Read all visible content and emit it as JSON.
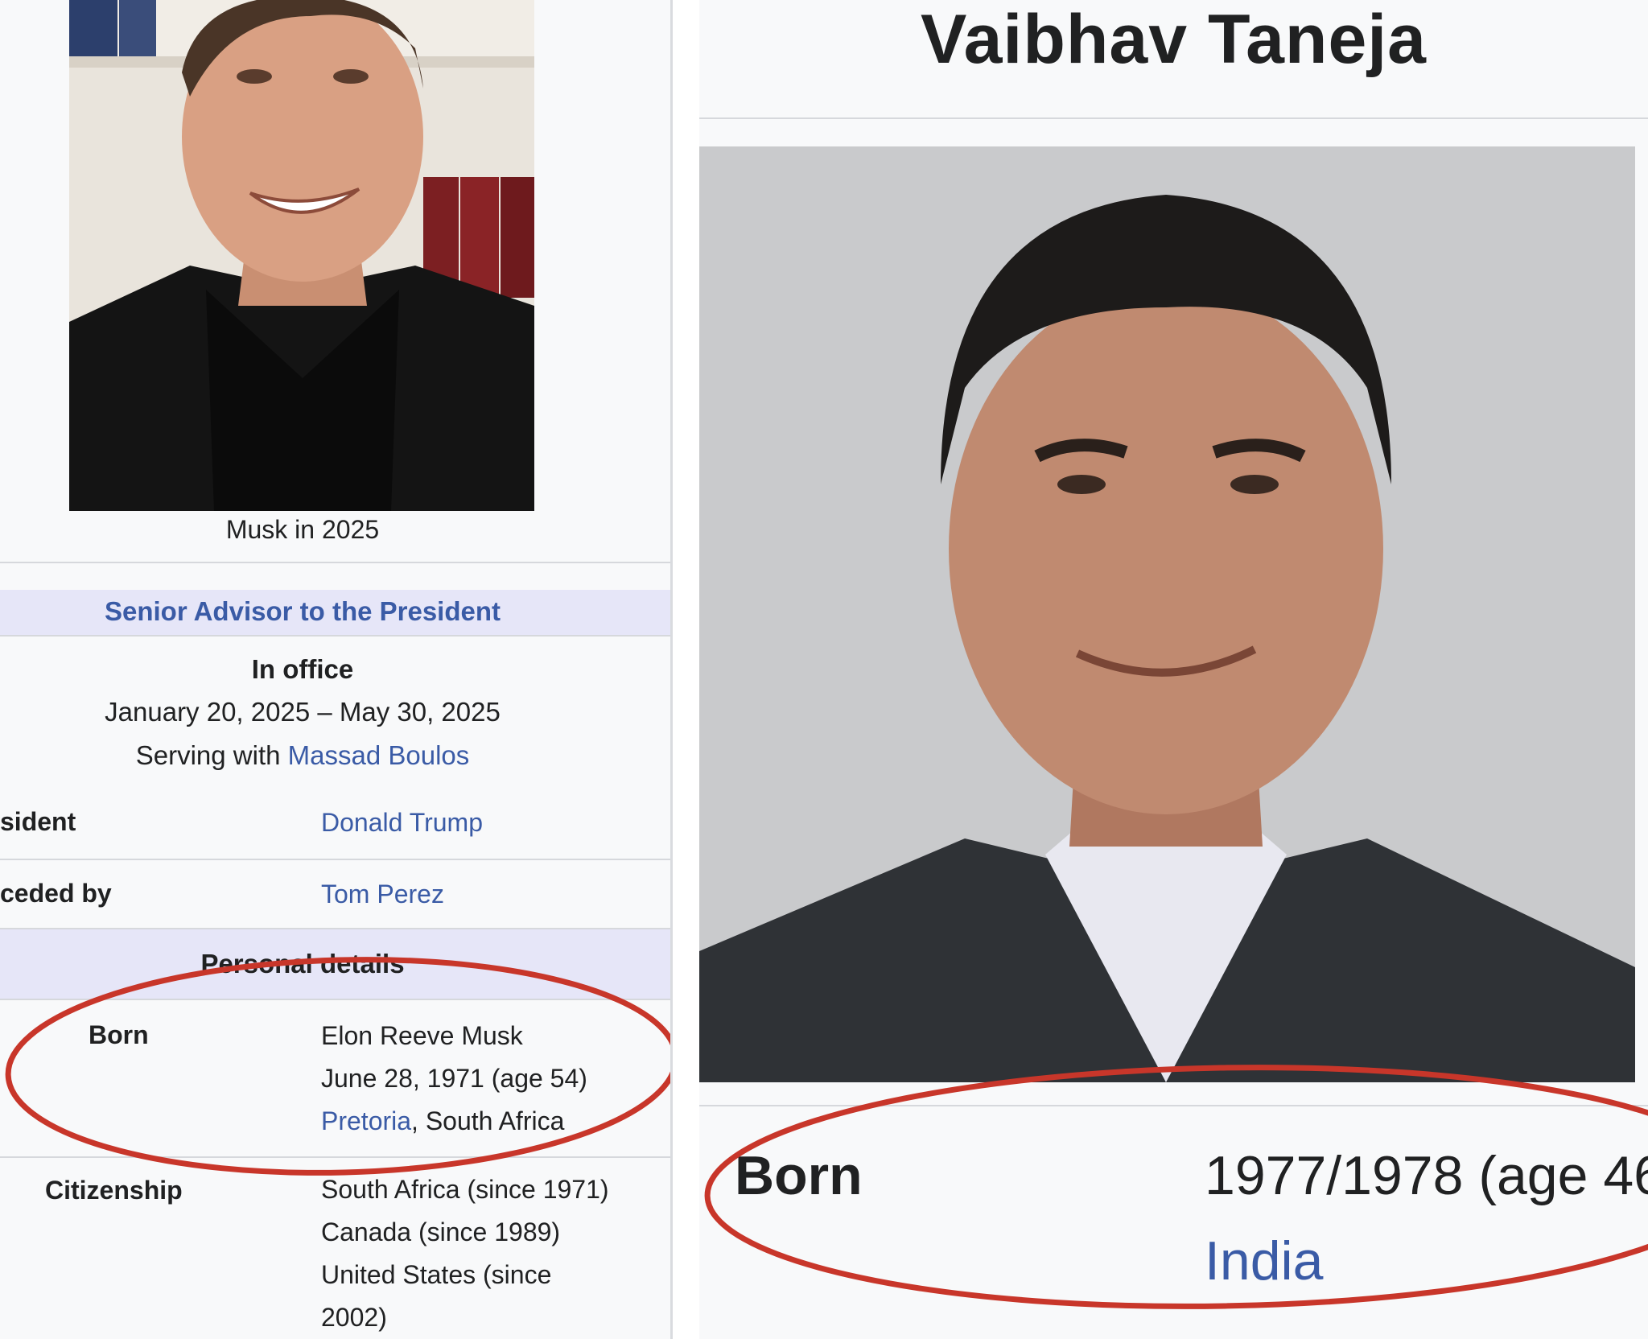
{
  "left_infobox": {
    "photo_alt": "Portrait of Elon Musk",
    "caption": "Musk in 2025",
    "section_header": "Senior Advisor to the President",
    "in_office_label": "In office",
    "term": "January 20, 2025 – May 30, 2025",
    "serving_with_prefix": "Serving with ",
    "serving_with_link": "Massad Boulos",
    "rows": [
      {
        "label": "sident",
        "value": "Donald Trump"
      },
      {
        "label": "ceded by",
        "value": "Tom Perez"
      }
    ],
    "personal_details_header": "Personal details",
    "born_label": "Born",
    "born_lines": {
      "name": "Elon Reeve Musk",
      "date": "June 28, 1971 (age 54)",
      "place_link": "Pretoria",
      "place_rest": ", South Africa"
    },
    "citizenship_label": "Citizenship",
    "citizenship_lines": [
      "South Africa (since 1971)",
      "Canada (since 1989)",
      "United States (since",
      "2002)"
    ]
  },
  "right_infobox": {
    "title": "Vaibhav Taneja",
    "photo_alt": "Portrait of Vaibhav Taneja",
    "born_label": "Born",
    "born_value": "1977/1978 (age 46",
    "born_place_link": "India"
  },
  "colors": {
    "link": "#3a5ba6",
    "header_band": "#e6e6f8",
    "highlight_oval": "#c8362a"
  }
}
